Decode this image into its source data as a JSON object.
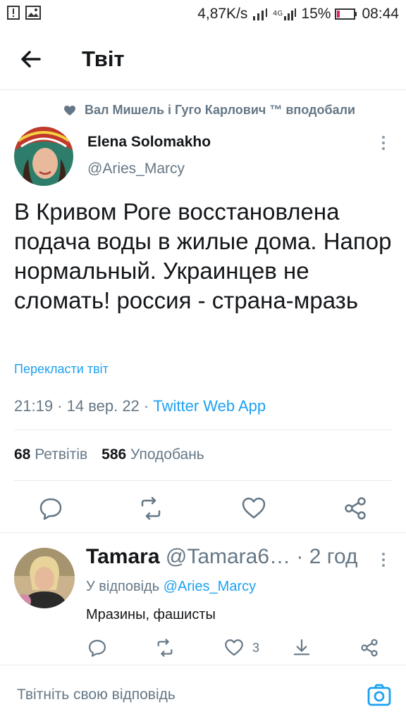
{
  "status_bar": {
    "speed": "4,87K/s",
    "battery": "15%",
    "time": "08:44"
  },
  "header": {
    "title": "Твіт"
  },
  "tweet": {
    "social_context": "Вал Мишель і Гуго Карлович ™ вподобали",
    "author_name": "Elena Solomakho",
    "author_handle": "@Aries_Marcy",
    "text": "В Кривом Роге восстановлена подача воды в жилые дома. Напор нормальный. Украинцев не сломать! россия - страна-мразь",
    "translate_label": "Перекласти твіт",
    "timestamp": "21:19 · 14 вер. 22 · ",
    "source": "Twitter Web App",
    "retweets_count": "68",
    "retweets_label": "Ретвітів",
    "likes_count": "586",
    "likes_label": "Уподобань"
  },
  "reply": {
    "name": "Tamara",
    "handle": "@Tamara6…",
    "time": "· 2 год",
    "reply_prefix": "У відповідь ",
    "reply_to": "@Aries_Marcy",
    "text": "Мразины, фашисты",
    "like_count": "3"
  },
  "compose": {
    "placeholder": "Твітніть свою відповідь"
  },
  "colors": {
    "accent": "#1da1f2",
    "muted": "#657786",
    "divider": "#e6ecf0"
  }
}
